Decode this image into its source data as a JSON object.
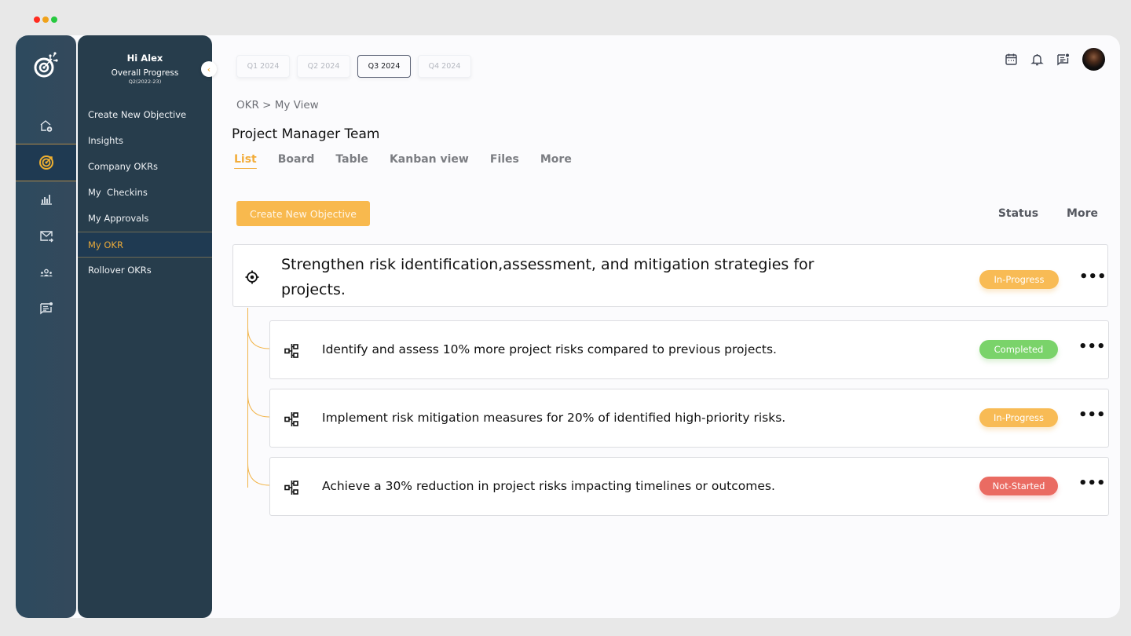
{
  "window": {
    "traffic_lights": [
      "close",
      "minimize",
      "maximize"
    ]
  },
  "rail": {
    "logo": "target-logo-icon",
    "items": [
      {
        "icon": "home-add-icon",
        "active": false
      },
      {
        "icon": "target-icon",
        "active": true
      },
      {
        "icon": "bar-chart-icon",
        "active": false
      },
      {
        "icon": "mail-forward-icon",
        "active": false
      },
      {
        "icon": "team-icon",
        "active": false
      },
      {
        "icon": "chat-note-icon",
        "active": false
      }
    ]
  },
  "subnav": {
    "greeting": "Hi Alex",
    "progress_label": "Overall Progress",
    "period": "Q2(2022-23)",
    "items": [
      {
        "label": "Create New Objective",
        "active": false
      },
      {
        "label": "Insights",
        "active": false
      },
      {
        "label": "Company OKRs",
        "active": false
      },
      {
        "label": "My  Checkins",
        "active": false
      },
      {
        "label": "My Approvals",
        "active": false
      },
      {
        "label": "My OKR",
        "active": true
      },
      {
        "label": "Rollover OKRs",
        "active": false
      }
    ],
    "collapse_icon": "chevron-left-icon"
  },
  "header": {
    "quarters": [
      {
        "label": "Q1 2024",
        "active": false
      },
      {
        "label": "Q2 2024",
        "active": false
      },
      {
        "label": "Q3 2024",
        "active": true
      },
      {
        "label": "Q4 2024",
        "active": false
      }
    ],
    "icons": [
      "calendar-icon",
      "bell-icon",
      "chat-note-icon"
    ],
    "avatar": "user-avatar"
  },
  "breadcrumb": "OKR > My View",
  "team_title": "Project Manager Team",
  "tabs": [
    {
      "label": "List",
      "active": true
    },
    {
      "label": "Board",
      "active": false
    },
    {
      "label": "Table",
      "active": false
    },
    {
      "label": "Kanban view",
      "active": false
    },
    {
      "label": "Files",
      "active": false
    },
    {
      "label": "More",
      "active": false
    }
  ],
  "toolbar": {
    "create_label": "Create New Objective",
    "status_label": "Status",
    "more_label": "More"
  },
  "colors": {
    "accent": "#f2ad3c",
    "in_progress": "#f8bb55",
    "completed": "#7ad36a",
    "not_started": "#ea6b62",
    "sidebar": "#273d4c"
  },
  "objective": {
    "text": "Strengthen risk identification,assessment, and mitigation strategies for projects.",
    "status": "In-Progress",
    "menu": "•••"
  },
  "key_results": [
    {
      "text": "Identify and assess 10% more project risks compared to previous projects.",
      "status": "Completed",
      "status_class": "completed",
      "menu": "•••"
    },
    {
      "text": "Implement risk mitigation measures for 20% of identified high-priority risks.",
      "status": "In-Progress",
      "status_class": "inprogress",
      "menu": "•••"
    },
    {
      "text": "Achieve a 30% reduction in project risks impacting timelines or outcomes.",
      "status": "Not-Started",
      "status_class": "notstarted",
      "menu": "•••"
    }
  ]
}
